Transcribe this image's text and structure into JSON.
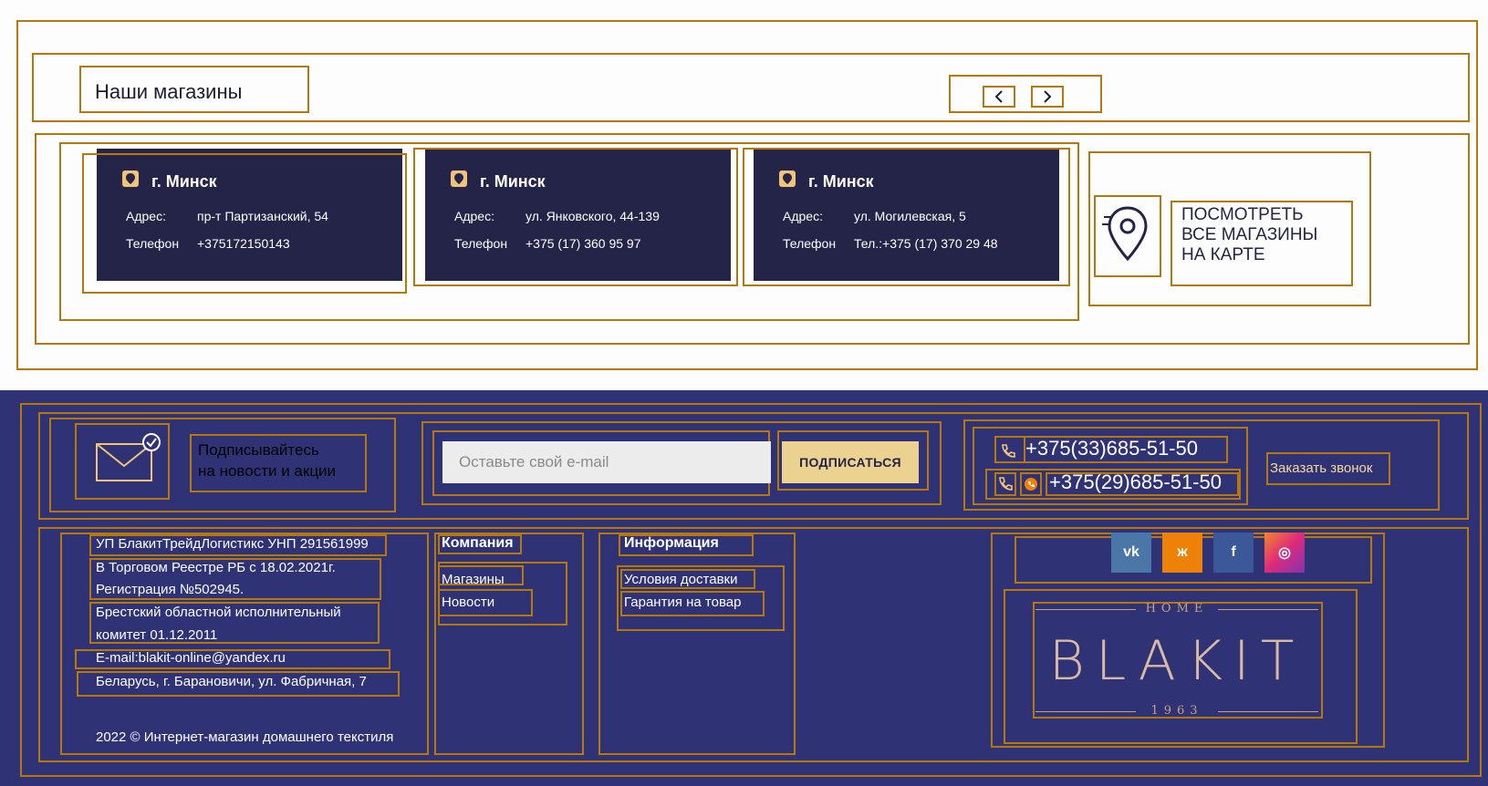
{
  "stores": {
    "title": "Наши магазины",
    "prev_icon": "chevron-left-icon",
    "next_icon": "chevron-right-icon",
    "cards": [
      {
        "city": "г. Минск",
        "addr_label": "Адрес:",
        "addr": "пр-т Партизанский, 54",
        "tel_label": "Телефон",
        "tel": "+375172150143"
      },
      {
        "city": "г. Минск",
        "addr_label": "Адрес:",
        "addr": "ул. Янковского, 44-139",
        "tel_label": "Телефон",
        "tel": "+375 (17) 360 95 97"
      },
      {
        "city": "г. Минск",
        "addr_label": "Адрес:",
        "addr": "ул. Могилевская, 5",
        "tel_label": "Телефон",
        "tel": "Тел.:+375 (17) 370 29 48"
      }
    ],
    "map_link": {
      "line1": "ПОСМОТРЕТЬ",
      "line2": "ВСЕ МАГАЗИНЫ",
      "line3": "НА КАРТЕ",
      "icon": "map-pin-icon"
    }
  },
  "subscribe": {
    "text_line1": "Подписывайтесь",
    "text_line2": "на новости и акции",
    "placeholder": "Оставьте свой e-mail",
    "button": "ПОДПИСАТЬСЯ",
    "icon": "envelope-icon"
  },
  "contacts": {
    "phone1": "+375(33)685-51-50",
    "phone2": "+375(29)685-51-50",
    "callback": "Заказать звонок"
  },
  "legal": {
    "line1": "УП БлакитТрейдЛогистикс УНП 291561999",
    "line2": "В Торговом Реестре РБ с 18.02.2021г.",
    "line3": "Регистрация №502945.",
    "line4": "Брестский областной исполнительный",
    "line5": "комитет 01.12.2011",
    "email": "E-mail:blakit-online@yandex.ru",
    "address": "Беларусь, г. Барановичи, ул. Фабричная, 7",
    "copyright": "2022 © Интернет-магазин домашнего текстиля"
  },
  "company": {
    "heading": "Компания",
    "links": [
      "Магазины",
      "Новости"
    ]
  },
  "info": {
    "heading": "Информация",
    "links": [
      "Условия доставки",
      "Гарантия на товар"
    ]
  },
  "social": [
    {
      "icon": "vk-icon",
      "glyph": "vk",
      "color": "#4a76a8"
    },
    {
      "icon": "odnoklassniki-icon",
      "glyph": "ж",
      "color": "#ee8208"
    },
    {
      "icon": "facebook-icon",
      "glyph": "f",
      "color": "#3b5998"
    },
    {
      "icon": "instagram-icon",
      "glyph": "◎",
      "color": "#c13584"
    }
  ],
  "logo": {
    "top": "HOME",
    "brand": "BLAKIT",
    "year": "1963"
  }
}
